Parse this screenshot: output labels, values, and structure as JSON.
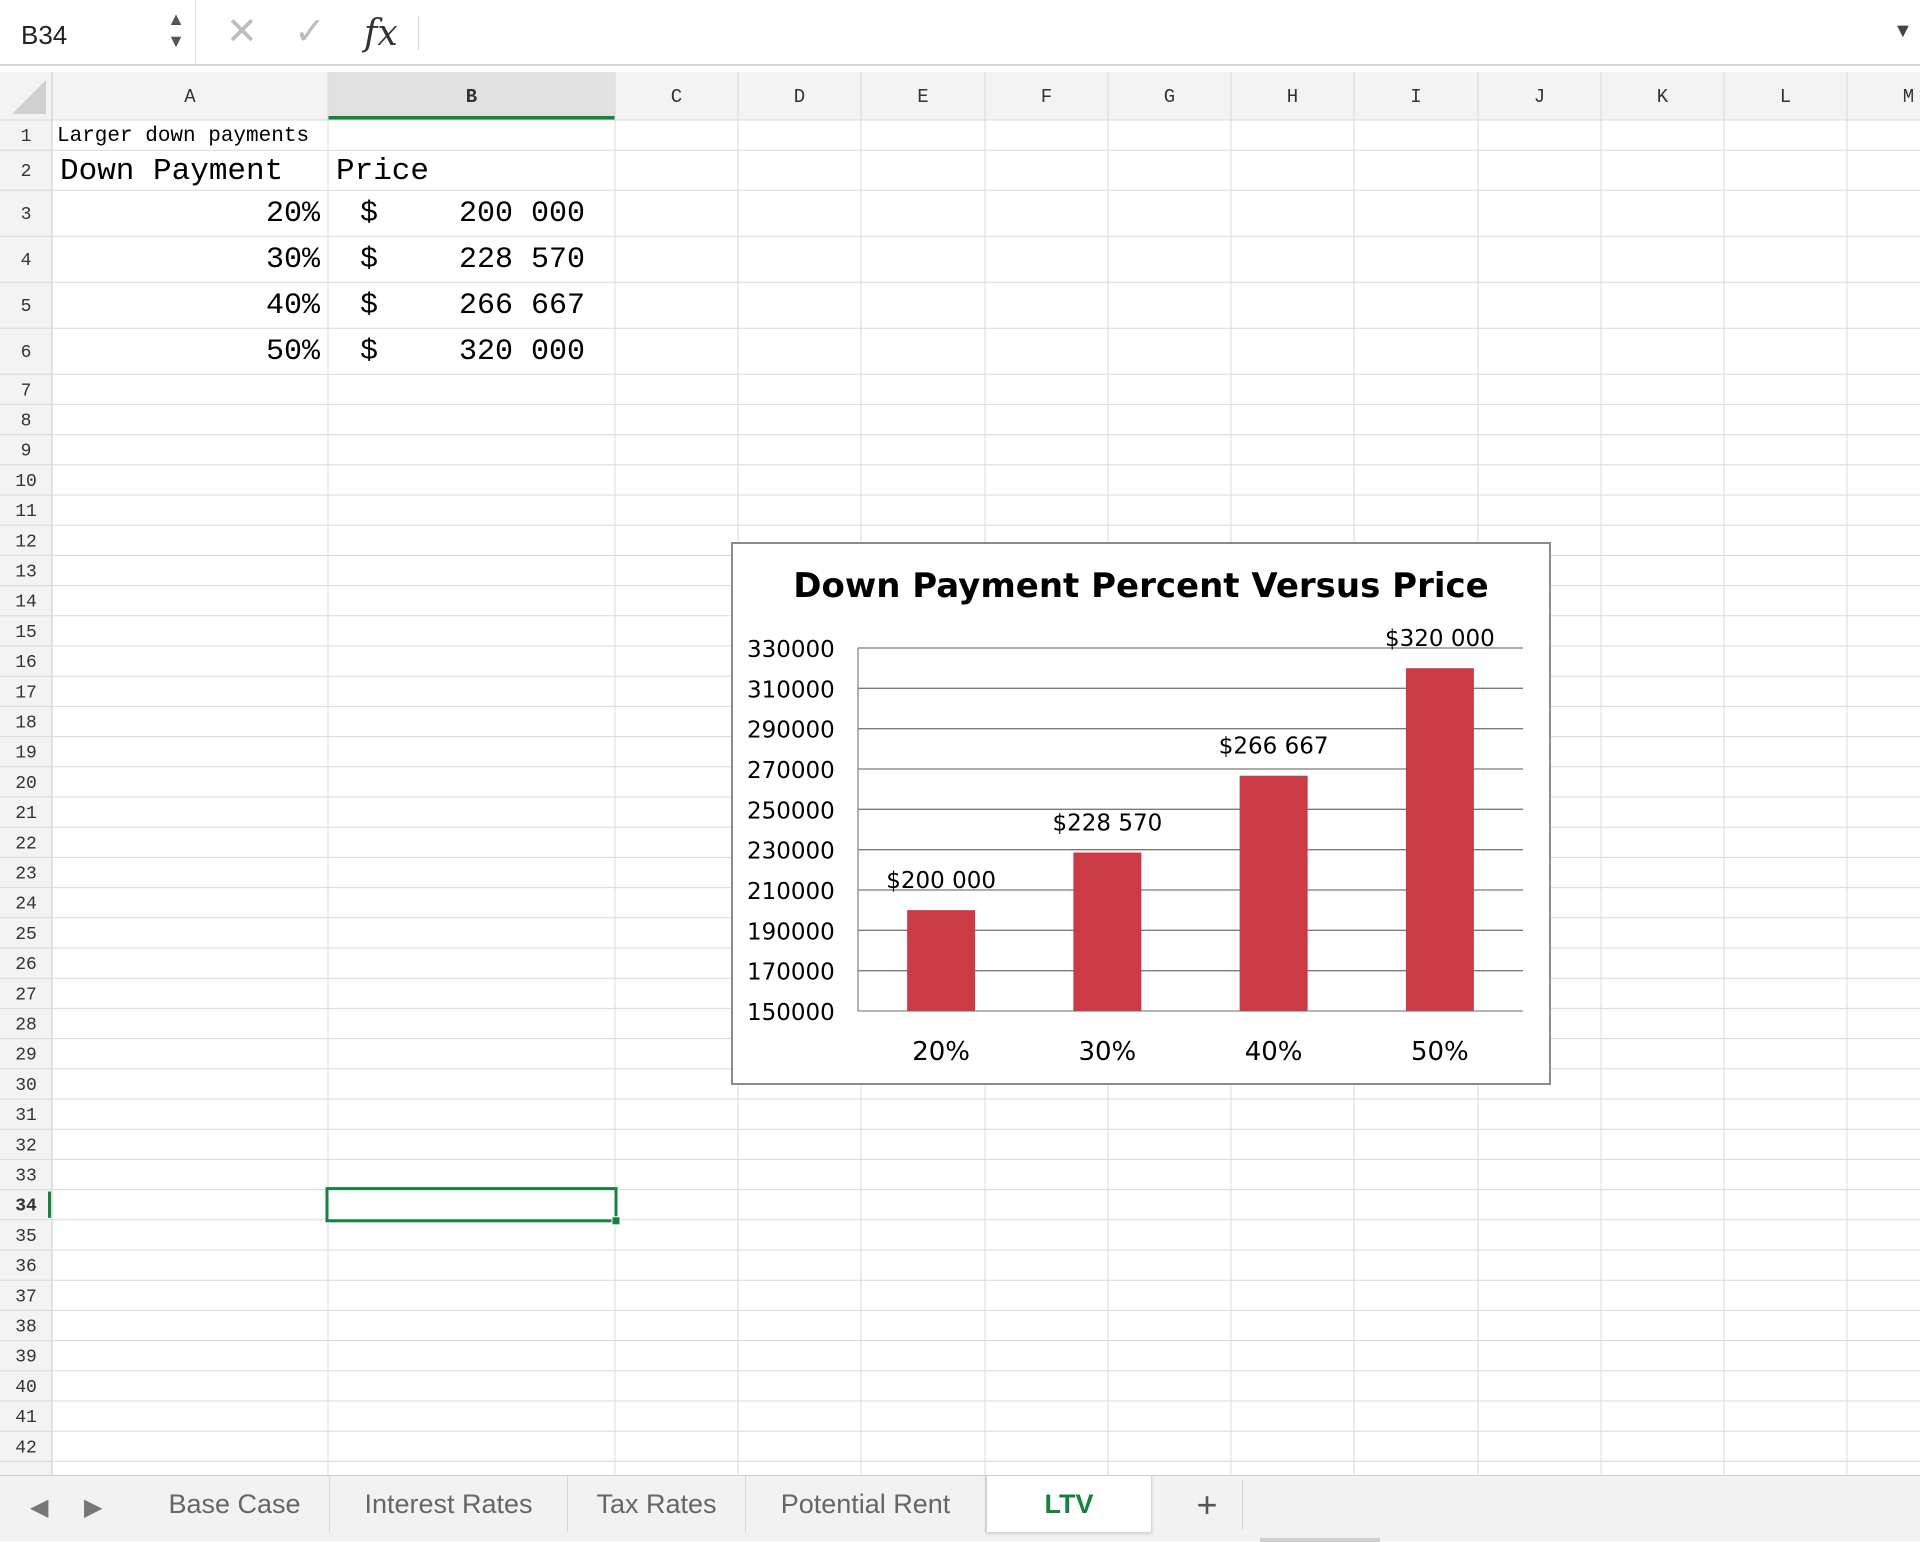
{
  "formula_bar": {
    "name_box": "B34",
    "stepper_up": "▲",
    "stepper_down": "▼",
    "cancel_icon": "✕",
    "confirm_icon": "✓",
    "fx_label": "fx",
    "formula": "",
    "expand_icon": "▼"
  },
  "grid": {
    "columns": [
      "A",
      "B",
      "C",
      "D",
      "E",
      "F",
      "G",
      "H",
      "I",
      "J",
      "K",
      "L",
      "M"
    ],
    "rows": [
      "1",
      "2",
      "3",
      "4",
      "5",
      "6",
      "7",
      "8",
      "9",
      "10",
      "11",
      "12",
      "13",
      "14",
      "15",
      "16",
      "17",
      "18",
      "19",
      "20",
      "21",
      "22",
      "23",
      "24",
      "25",
      "26",
      "27",
      "28",
      "29",
      "30",
      "31",
      "32",
      "33",
      "34",
      "35",
      "36",
      "37",
      "38",
      "39",
      "40",
      "41",
      "42"
    ],
    "selected_column": "B",
    "selected_row": "34",
    "accent_color": "#17813f",
    "cells": {
      "A1": "Larger down payments",
      "A2": "Down Payment",
      "B2": "Price",
      "table": [
        {
          "down_payment": "20%",
          "currency": "$",
          "price": "200 000"
        },
        {
          "down_payment": "30%",
          "currency": "$",
          "price": "228 570"
        },
        {
          "down_payment": "40%",
          "currency": "$",
          "price": "266 667"
        },
        {
          "down_payment": "50%",
          "currency": "$",
          "price": "320 000"
        }
      ]
    }
  },
  "chart_data": {
    "type": "bar",
    "title": "Down Payment Percent Versus Price",
    "categories": [
      "20%",
      "30%",
      "40%",
      "50%"
    ],
    "values": [
      200000,
      228570,
      266667,
      320000
    ],
    "data_labels": [
      "$200 000",
      "$228 570",
      "$266 667",
      "$320 000"
    ],
    "y_ticks": [
      "330000",
      "310000",
      "290000",
      "270000",
      "250000",
      "230000",
      "210000",
      "190000",
      "170000",
      "150000"
    ],
    "ylim": [
      150000,
      330000
    ],
    "grid": true,
    "legend": "none",
    "bar_color": "#cc3a45"
  },
  "sheet_tabs": {
    "prev_icon": "◀",
    "next_icon": "▶",
    "tabs": [
      {
        "label": "Base Case",
        "active": false
      },
      {
        "label": "Interest Rates",
        "active": false
      },
      {
        "label": "Tax Rates",
        "active": false
      },
      {
        "label": "Potential Rent",
        "active": false
      },
      {
        "label": "LTV",
        "active": true
      }
    ],
    "add_icon": "+"
  }
}
